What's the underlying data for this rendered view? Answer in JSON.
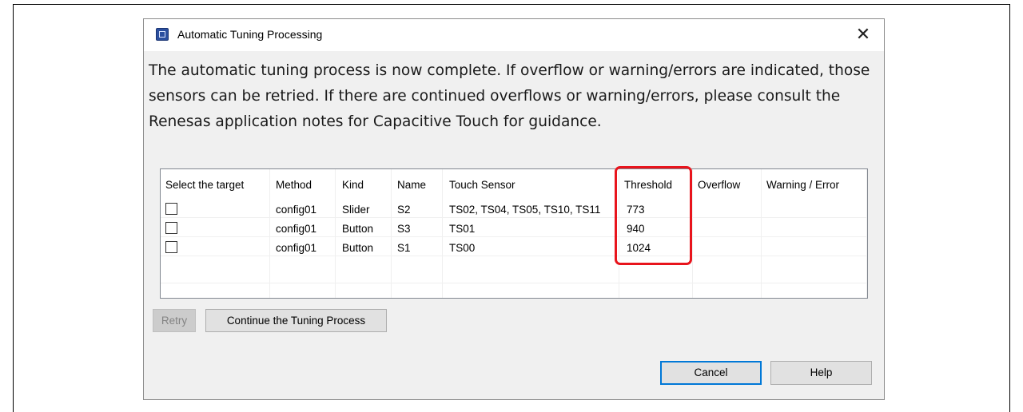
{
  "window": {
    "title": "Automatic Tuning Processing",
    "close_glyph": "✕"
  },
  "message": "The automatic tuning process is now complete. If overflow or warning/errors are indicated, those sensors can be retried. If there are continued overflows or warning/errors, please consult the Renesas application notes for Capacitive Touch for guidance.",
  "table": {
    "headers": {
      "select": "Select the target",
      "method": "Method",
      "kind": "Kind",
      "name": "Name",
      "touch_sensor": "Touch Sensor",
      "threshold": "Threshold",
      "overflow": "Overflow",
      "warning_error": "Warning / Error"
    },
    "rows": [
      {
        "checked": false,
        "method": "config01",
        "kind": "Slider",
        "name": "S2",
        "touch_sensor": "TS02, TS04, TS05, TS10, TS11",
        "threshold": "773",
        "overflow": "",
        "warning_error": ""
      },
      {
        "checked": false,
        "method": "config01",
        "kind": "Button",
        "name": "S3",
        "touch_sensor": "TS01",
        "threshold": "940",
        "overflow": "",
        "warning_error": ""
      },
      {
        "checked": false,
        "method": "config01",
        "kind": "Button",
        "name": "S1",
        "touch_sensor": "TS00",
        "threshold": "1024",
        "overflow": "",
        "warning_error": ""
      }
    ]
  },
  "buttons": {
    "retry": "Retry",
    "continue": "Continue the Tuning Process",
    "cancel": "Cancel",
    "help": "Help"
  },
  "colors": {
    "highlight": "#e8141c",
    "default_button_border": "#0078d7"
  }
}
